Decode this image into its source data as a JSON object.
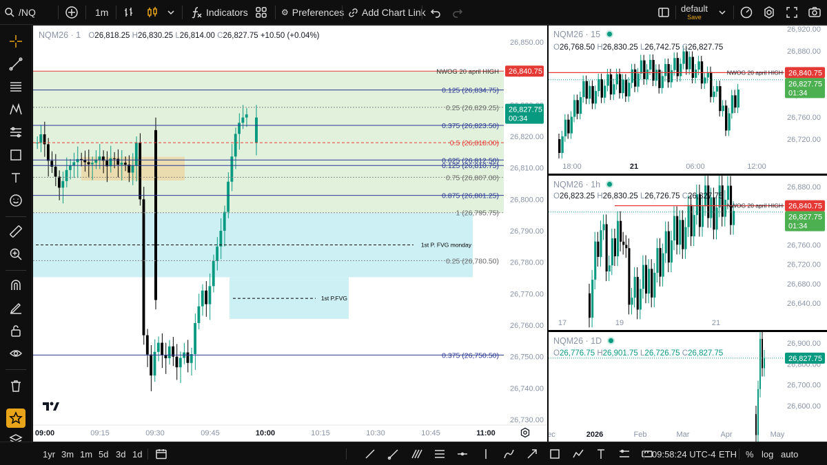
{
  "toolbar": {
    "symbol": "/NQ",
    "interval": "1m",
    "indicators_label": "Indicators",
    "preferences_label": "Preferences",
    "add_chart_link_label": "Add Chart Link",
    "layout_name": "default",
    "layout_status": "Save"
  },
  "main_chart": {
    "symbol_line": "NQM26 · 1",
    "ohlc": {
      "o_label": "O",
      "o": "26,818.25",
      "h_label": "H",
      "h": "26,830.25",
      "l_label": "L",
      "l": "26,814.00",
      "c_label": "C",
      "c": "26,827.75",
      "change": "+10.50 (+0.04%)"
    },
    "y_ticks": [
      "26,850.00",
      "26,840.00",
      "26,830.00",
      "26,820.00",
      "26,810.00",
      "26,800.00",
      "26,790.00",
      "26,780.00",
      "26,770.00",
      "26,760.00",
      "26,750.00",
      "26,740.00",
      "26,730.00"
    ],
    "x_ticks": [
      "09:00",
      "09:15",
      "09:30",
      "09:45",
      "10:00",
      "10:15",
      "10:30",
      "10:45",
      "11:00"
    ],
    "levels": [
      {
        "label": "NWOG 20 april HIGH",
        "price": 26840.75,
        "color": "#e53935"
      },
      {
        "label": "0.125 (26,834.75)",
        "price": 26834.75,
        "color": "#283593"
      },
      {
        "label": "0.25 (26,829.25)",
        "price": 26829.25,
        "color": "#888888"
      },
      {
        "label": "0.375 (26,823.50)",
        "price": 26823.5,
        "color": "#283593"
      },
      {
        "label": "0.5 (26,818.00)",
        "price": 26818.0,
        "color": "#e53935"
      },
      {
        "label": "0.625 (26,812.50)",
        "price": 26812.5,
        "color": "#283593"
      },
      {
        "label": "0.125 (26,810.75)",
        "price": 26810.75,
        "color": "#283593"
      },
      {
        "label": "0.75 (26,807.00)",
        "price": 26807.0,
        "color": "#888888"
      },
      {
        "label": "0.875 (26,801.25)",
        "price": 26801.25,
        "color": "#283593"
      },
      {
        "label": "1 (26,795.75)",
        "price": 26795.75,
        "color": "#888888"
      },
      {
        "label": "0.25 (26,780.50)",
        "price": 26780.5,
        "color": "#888888"
      },
      {
        "label": "0.375 (26,750.50)",
        "price": 26750.5,
        "color": "#283593"
      }
    ],
    "fvg_labels": [
      "1st P. FVG monday",
      "1st P.FVG"
    ],
    "price_badges": [
      {
        "text": "26,840.75",
        "color": "#e53935"
      },
      {
        "text": "26,827.75",
        "sub": "00:34",
        "color": "#089981"
      }
    ]
  },
  "chart_15": {
    "symbol_line": "NQM26 · 15",
    "ohlc": {
      "o": "26,768.50",
      "h": "26,830.25",
      "l": "26,742.75",
      "c": "26,827.75"
    },
    "level_label": "NWOG 20 april HIGH",
    "y_ticks": [
      "26,920.00",
      "26,880.00",
      "26,840.00",
      "26,800.00",
      "26,760.00",
      "26,720.00"
    ],
    "x_ticks": [
      "18:00",
      "21",
      "06:00",
      "12:00"
    ],
    "badges": [
      {
        "text": "26,840.75"
      },
      {
        "text": "26,827.75",
        "sub": "01:34"
      }
    ]
  },
  "chart_1h": {
    "symbol_line": "NQM26 · 1h",
    "ohlc": {
      "o": "26,823.25",
      "h": "26,830.25",
      "l": "26,726.75",
      "c": "26,827.75"
    },
    "level_label": "NWOG 20 april HIGH",
    "y_ticks": [
      "26,880.00",
      "26,840.00",
      "26,800.00",
      "26,760.00",
      "26,720.00",
      "26,680.00",
      "26,640.00"
    ],
    "x_ticks": [
      "17",
      "19",
      "21"
    ],
    "badges": [
      {
        "text": "26,840.75"
      },
      {
        "text": "26,827.75",
        "sub": "01:34"
      }
    ]
  },
  "chart_1d": {
    "symbol_line": "NQM26 · 1D",
    "ohlc": {
      "o": "26,776.75",
      "h": "26,901.75",
      "l": "26,726.75",
      "c": "26,827.75"
    },
    "y_ticks": [
      "26,900.00",
      "26,800.00",
      "26,700.00",
      "26,600.00"
    ],
    "x_ticks": [
      "ec",
      "2026",
      "Feb",
      "Mar",
      "Apr",
      "May"
    ],
    "badges": [
      {
        "text": "26,827.75"
      }
    ]
  },
  "bottombar": {
    "ranges": [
      "1yr",
      "3m",
      "1m",
      "5d",
      "3d",
      "1d"
    ],
    "time": "09:58:24 UTC-4",
    "session": "ETH",
    "percent": "%",
    "log": "log",
    "auto": "auto"
  },
  "colors": {
    "up": "#089981",
    "down": "#000000",
    "accent": "#e9a51a",
    "ink": "#131722"
  }
}
